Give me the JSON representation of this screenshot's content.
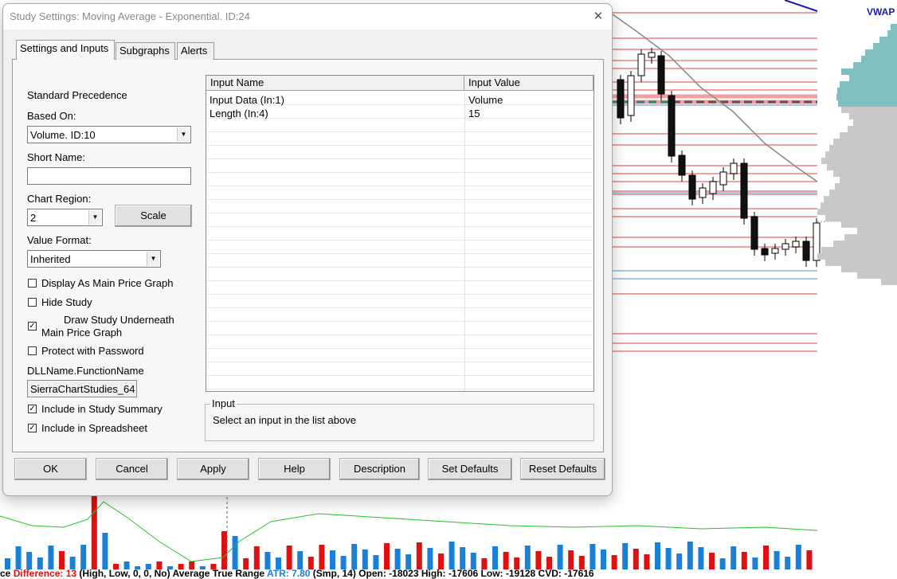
{
  "window": {
    "title": "Study Settings: Moving Average - Exponential. ID:24",
    "close_glyph": "✕"
  },
  "tabs": [
    {
      "label": "Settings and Inputs",
      "active": true
    },
    {
      "label": "Subgraphs",
      "active": false
    },
    {
      "label": "Alerts",
      "active": false
    }
  ],
  "settings": {
    "standard_precedence": "Standard Precedence",
    "based_on_label": "Based On:",
    "based_on_value": "Volume. ID:10",
    "short_name_label": "Short Name:",
    "short_name_value": "",
    "chart_region_label": "Chart Region:",
    "chart_region_value": "2",
    "scale_button": "Scale",
    "value_format_label": "Value Format:",
    "value_format_value": "Inherited",
    "checkboxes": [
      {
        "label": "Display As Main Price Graph",
        "checked": false
      },
      {
        "label": "Hide Study",
        "checked": false
      },
      {
        "label": "Draw Study Underneath",
        "label2": "Main Price Graph",
        "checked": true
      },
      {
        "label": "Protect with Password",
        "checked": false
      }
    ],
    "dll_label": "DLLName.FunctionName",
    "dll_value": "SierraChartStudies_64",
    "include_summary": {
      "label": "Include in Study Summary",
      "checked": true
    },
    "include_spreadsheet": {
      "label": "Include in Spreadsheet",
      "checked": true
    }
  },
  "inputs_table": {
    "headers": [
      "Input Name",
      "Input Value"
    ],
    "rows": [
      {
        "name": "Input Data  (In:1)",
        "value": "Volume"
      },
      {
        "name": "Length  (In:4)",
        "value": "15"
      }
    ]
  },
  "input_group": {
    "title": "Input",
    "description": "Select an input in the list above"
  },
  "buttons": {
    "ok": "OK",
    "cancel": "Cancel",
    "apply": "Apply",
    "help": "Help",
    "description": "Description",
    "set_defaults": "Set Defaults",
    "reset_defaults": "Reset Defaults"
  },
  "chart": {
    "vwap_label": "VWAP",
    "status_parts": [
      {
        "text": "ce ",
        "color": "#000000"
      },
      {
        "text": "Difference: 13",
        "color": "#e01010"
      },
      {
        "text": "  (High, Low, 0, 0, No)  Average True Range  ",
        "color": "#000000"
      },
      {
        "text": "ATR: 7.80",
        "color": "#1a7fd6"
      },
      {
        "text": "  (Smp, 14)  Open: -18023  High: -17606  Low: -19128  CVD: -17616",
        "color": "#000000"
      }
    ],
    "colors": {
      "resistance": "#f0a0a0",
      "support": "#a8c8e8",
      "profile": "#7fbfbf",
      "up_bar": "#1a7fd6",
      "down_bar": "#e01010",
      "atr_line": "#28c028"
    }
  }
}
